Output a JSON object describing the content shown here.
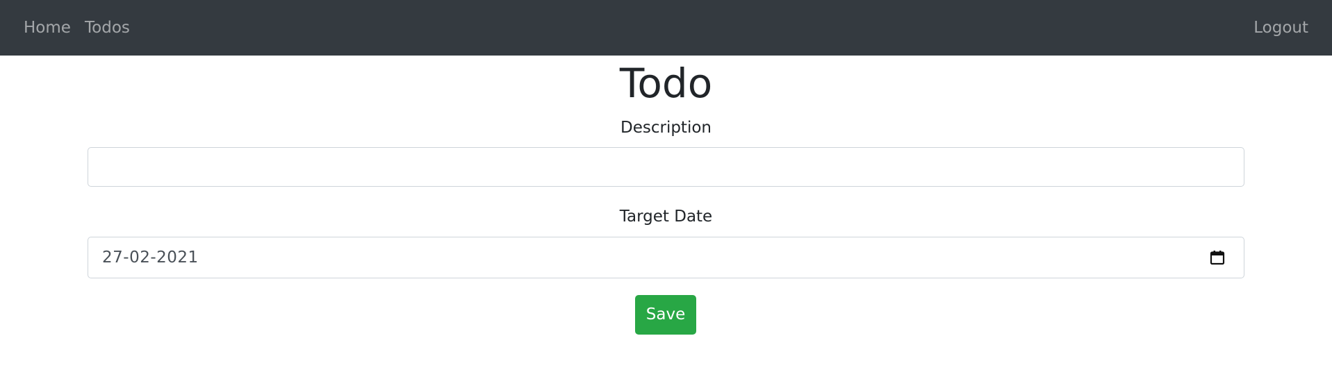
{
  "navbar": {
    "links": [
      {
        "label": "Home"
      },
      {
        "label": "Todos"
      }
    ],
    "logout_label": "Logout"
  },
  "page": {
    "title": "Todo"
  },
  "form": {
    "description": {
      "label": "Description",
      "value": ""
    },
    "target_date": {
      "label": "Target Date",
      "value": "27-02-2021"
    },
    "save_label": "Save"
  },
  "icons": {
    "date_picker": "calendar-icon"
  },
  "colors": {
    "navbar_bg": "#343a40",
    "nav_link": "#9a9da0",
    "save_button": "#28a745",
    "text": "#212529"
  }
}
